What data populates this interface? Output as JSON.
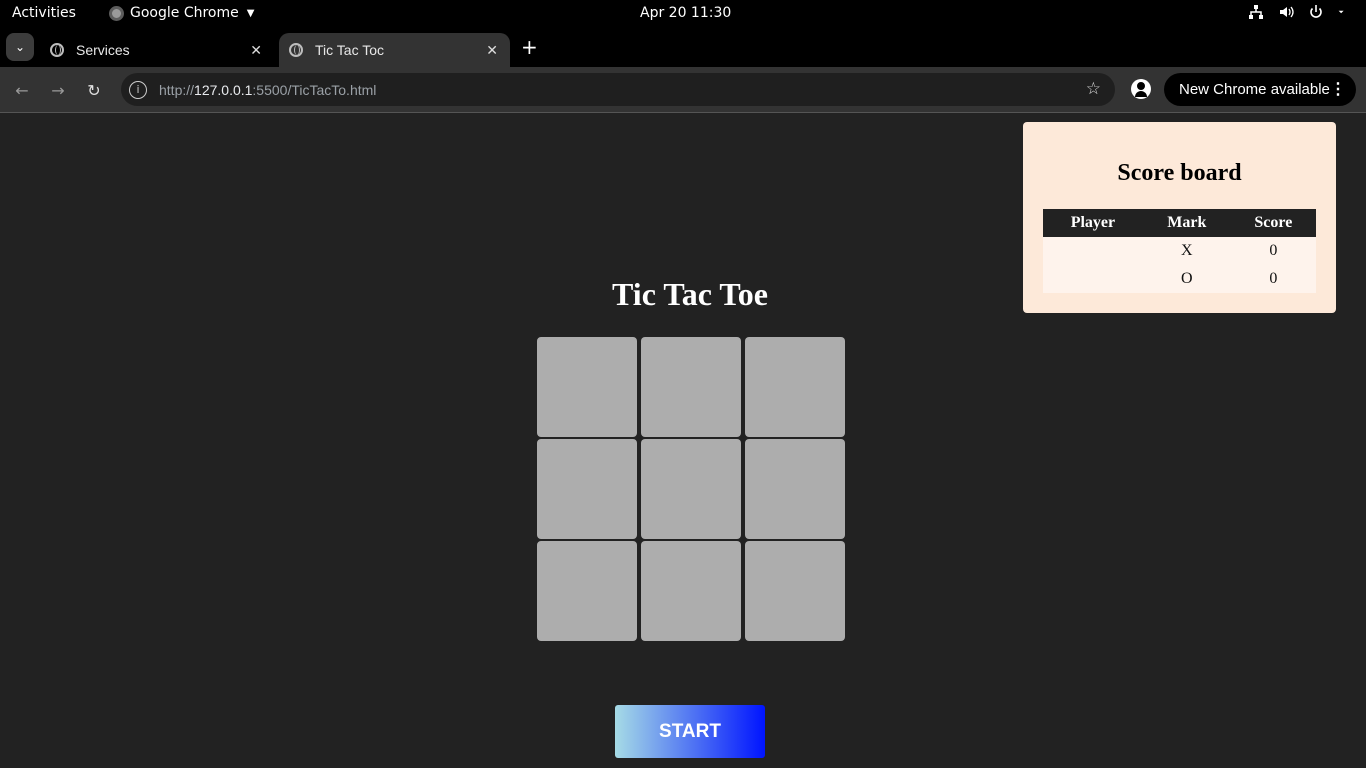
{
  "system_bar": {
    "activities": "Activities",
    "app_name": "Google Chrome",
    "clock": "Apr 20  11:30"
  },
  "browser": {
    "tabs": [
      {
        "title": "Services"
      },
      {
        "title": "Tic Tac Toc"
      }
    ],
    "url_prefix": "http://",
    "url_host": "127.0.0.1",
    "url_rest": ":5500/TicTacTo.html",
    "update_label": "New Chrome available"
  },
  "game": {
    "title": "Tic Tac Toe",
    "start_label": "START",
    "cells": [
      "",
      "",
      "",
      "",
      "",
      "",
      "",
      "",
      ""
    ]
  },
  "scoreboard": {
    "title": "Score board",
    "headers": [
      "Player",
      "Mark",
      "Score"
    ],
    "rows": [
      {
        "player": "",
        "mark": "X",
        "score": "0"
      },
      {
        "player": "",
        "mark": "O",
        "score": "0"
      }
    ],
    "colors": {
      "x": "#0000ee",
      "o": "#118811"
    }
  }
}
